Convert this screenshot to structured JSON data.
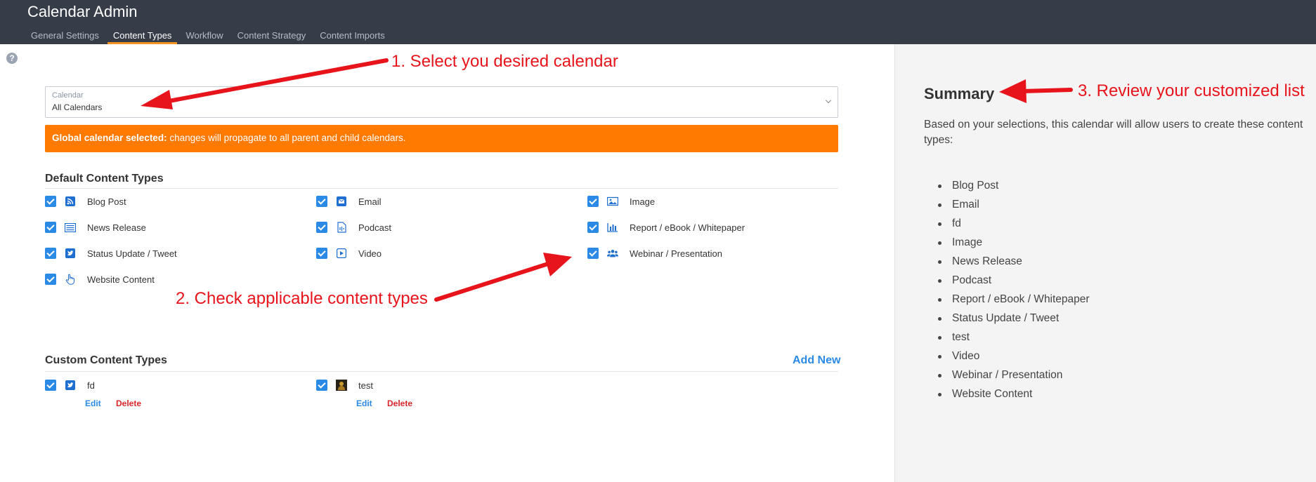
{
  "header": {
    "title": "Calendar Admin",
    "tabs": [
      {
        "label": "General Settings",
        "active": false
      },
      {
        "label": "Content Types",
        "active": true
      },
      {
        "label": "Workflow",
        "active": false
      },
      {
        "label": "Content Strategy",
        "active": false
      },
      {
        "label": "Content Imports",
        "active": false
      }
    ]
  },
  "help": {
    "glyph": "?"
  },
  "calendar_select": {
    "label": "Calendar",
    "value": "All Calendars"
  },
  "alert": {
    "bold": "Global calendar selected:",
    "text": " changes will propagate to all parent and child calendars.",
    "color": "#ff7a00"
  },
  "default_types": {
    "title": "Default Content Types",
    "items": [
      {
        "label": "Blog Post",
        "icon": "rss-icon",
        "checked": true
      },
      {
        "label": "Email",
        "icon": "email-icon",
        "checked": true
      },
      {
        "label": "Image",
        "icon": "image-icon",
        "checked": true
      },
      {
        "label": "News Release",
        "icon": "newspaper-icon",
        "checked": true
      },
      {
        "label": "Podcast",
        "icon": "audio-file-icon",
        "checked": true
      },
      {
        "label": "Report / eBook / Whitepaper",
        "icon": "bar-chart-icon",
        "checked": true
      },
      {
        "label": "Status Update / Tweet",
        "icon": "twitter-icon",
        "checked": true
      },
      {
        "label": "Video",
        "icon": "video-icon",
        "checked": true
      },
      {
        "label": "Webinar / Presentation",
        "icon": "users-icon",
        "checked": true
      },
      {
        "label": "Website Content",
        "icon": "pointer-hand-icon",
        "checked": true
      }
    ]
  },
  "custom_types": {
    "title": "Custom Content Types",
    "add_label": "Add New",
    "items": [
      {
        "label": "fd",
        "icon": "twitter-icon",
        "checked": true,
        "edit_label": "Edit",
        "delete_label": "Delete"
      },
      {
        "label": "test",
        "icon": "custom-image-icon",
        "checked": true,
        "edit_label": "Edit",
        "delete_label": "Delete"
      }
    ]
  },
  "summary": {
    "title": "Summary",
    "description": "Based on your selections, this calendar will allow users to create these content types:",
    "items": [
      "Blog Post",
      "Email",
      "fd",
      "Image",
      "News Release",
      "Podcast",
      "Report / eBook / Whitepaper",
      "Status Update / Tweet",
      "test",
      "Video",
      "Webinar / Presentation",
      "Website Content"
    ]
  },
  "annotations": {
    "step1": "1. Select you desired calendar",
    "step2": "2. Check applicable content types",
    "step3": "3. Review your customized list",
    "color": "#e8141c"
  },
  "colors": {
    "accent": "#2b8ae6",
    "header_bg": "#363c48",
    "tab_underline": "#f39325",
    "delete": "#d9262a"
  }
}
